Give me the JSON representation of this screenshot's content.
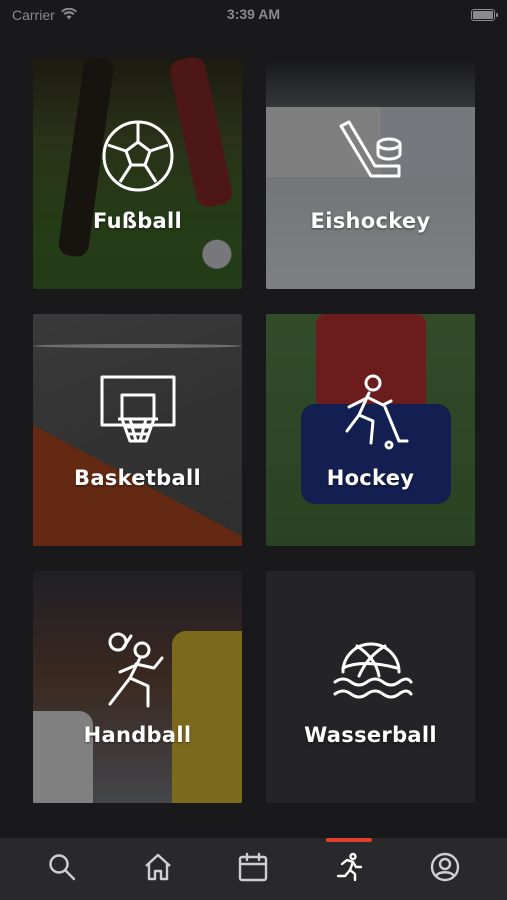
{
  "status_bar": {
    "carrier": "Carrier",
    "time": "3:39 AM",
    "wifi_icon": "wifi-icon",
    "battery_icon": "battery-icon"
  },
  "sports": [
    {
      "label": "Fußball",
      "icon": "soccer-ball-icon"
    },
    {
      "label": "Eishockey",
      "icon": "ice-hockey-icon"
    },
    {
      "label": "Basketball",
      "icon": "basketball-hoop-icon"
    },
    {
      "label": "Hockey",
      "icon": "field-hockey-player-icon"
    },
    {
      "label": "Handball",
      "icon": "handball-player-icon"
    },
    {
      "label": "Wasserball",
      "icon": "water-polo-icon"
    }
  ],
  "tab_bar": {
    "items": [
      {
        "icon": "search-icon"
      },
      {
        "icon": "home-icon"
      },
      {
        "icon": "calendar-icon"
      },
      {
        "icon": "running-person-icon",
        "active": true
      },
      {
        "icon": "profile-icon"
      }
    ],
    "active_color": "#e5402e"
  },
  "colors": {
    "background": "#19181b",
    "tab_bar": "#29282b",
    "accent": "#e5402e"
  }
}
